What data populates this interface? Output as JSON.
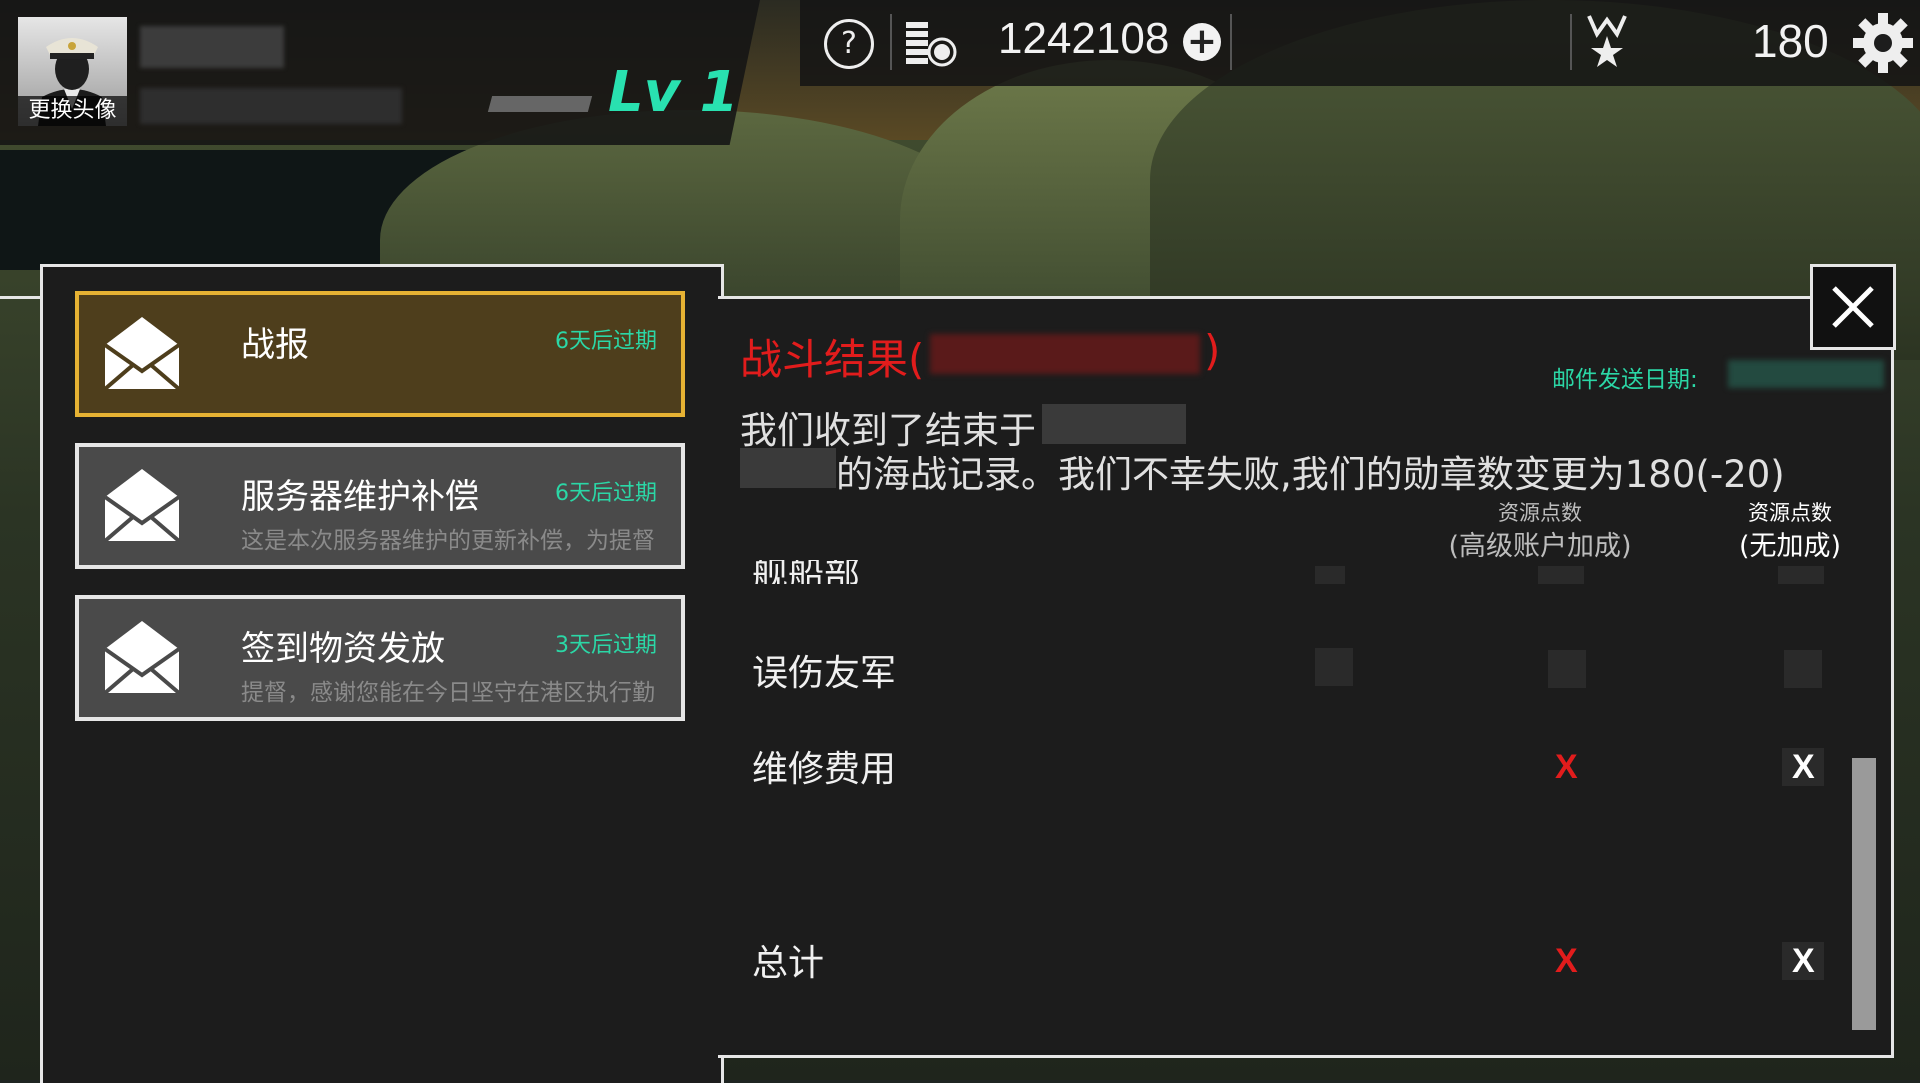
{
  "header": {
    "avatar_label": "更换头像",
    "level": "Lv 1",
    "coins": "1242108",
    "medals": "180"
  },
  "mails": [
    {
      "title": "战报",
      "expiry": "6天后过期",
      "preview": ""
    },
    {
      "title": "服务器维护补偿",
      "expiry": "6天后过期",
      "preview": "这是本次服务器维护的更新补偿，为提督"
    },
    {
      "title": "签到物资发放",
      "expiry": "3天后过期",
      "preview": "提督，感谢您能在今日坚守在港区执行勤"
    }
  ],
  "detail": {
    "title_prefix": "战斗结果(",
    "title_suffix": ")",
    "send_date_label": "邮件发送日期:",
    "message_line1": "我们收到了结束于",
    "message_line2": "的海战记录。我们不幸失败,我们的勋章数变更为180(-20)",
    "columns": [
      {
        "line1": "资源点数",
        "line2": "(高级账户加成)"
      },
      {
        "line1": "资源点数",
        "line2": "(无加成)"
      }
    ],
    "partial_row_label": "舰船部件",
    "rows": [
      {
        "label": "误伤友军",
        "premium": "",
        "normal": ""
      },
      {
        "label": "维修费用",
        "premium": "X",
        "normal": "X"
      },
      {
        "label": "总计",
        "premium": "X",
        "normal": "X"
      }
    ]
  },
  "colors": {
    "accent_green": "#29e1b0",
    "alert_red": "#e21c1c",
    "active_border": "#e6b233"
  },
  "icons": [
    "help-icon",
    "coin-icon",
    "plus-icon",
    "medal-icon",
    "gear-icon",
    "envelope-icon",
    "close-icon"
  ]
}
